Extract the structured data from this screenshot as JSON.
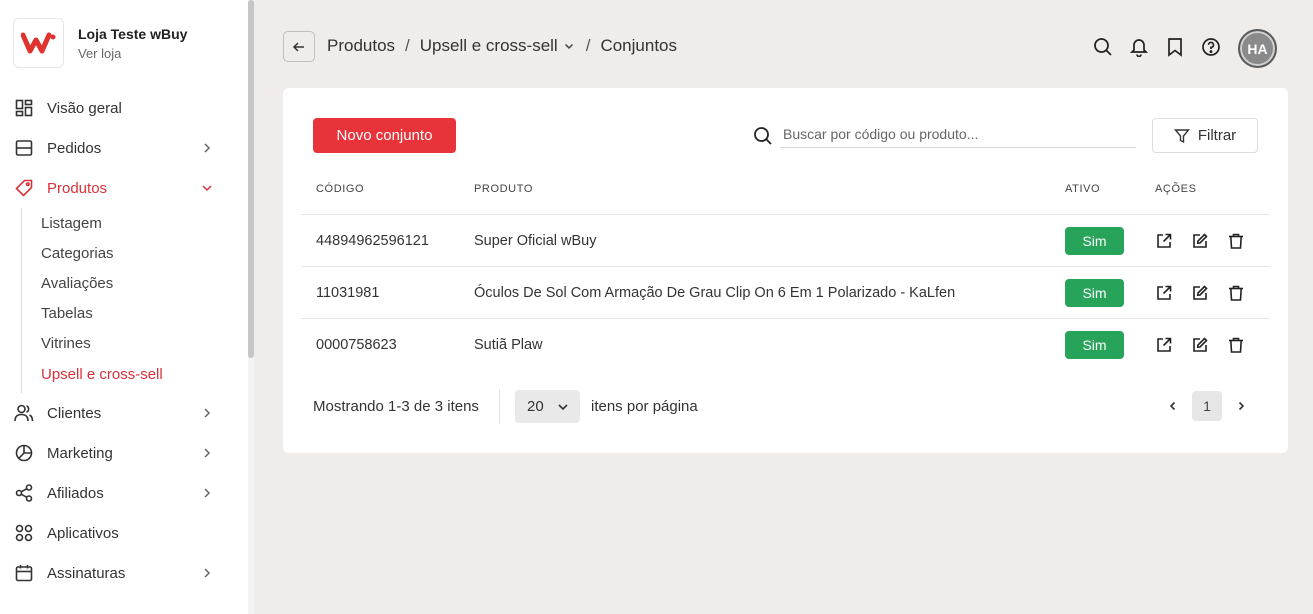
{
  "store": {
    "name": "Loja Teste wBuy",
    "link": "Ver loja"
  },
  "colors": {
    "accent": "#e8333a",
    "active_nav": "#d9323a",
    "badge_green": "#27a35a"
  },
  "sidebar": {
    "items": [
      {
        "label": "Visão geral",
        "icon": "dashboard-icon"
      },
      {
        "label": "Pedidos",
        "icon": "orders-icon"
      },
      {
        "label": "Produtos",
        "icon": "tag-icon"
      },
      {
        "label": "Clientes",
        "icon": "users-icon"
      },
      {
        "label": "Marketing",
        "icon": "pie-chart-icon"
      },
      {
        "label": "Afiliados",
        "icon": "share-icon"
      },
      {
        "label": "Aplicativos",
        "icon": "apps-icon"
      },
      {
        "label": "Assinaturas",
        "icon": "calendar-icon"
      }
    ],
    "produtos_sub": [
      "Listagem",
      "Categorias",
      "Avaliações",
      "Tabelas",
      "Vitrines",
      "Upsell e cross-sell"
    ]
  },
  "breadcrumb": {
    "items": [
      "Produtos",
      "Upsell e cross-sell",
      "Conjuntos"
    ]
  },
  "header": {
    "avatar": "HA"
  },
  "toolbar": {
    "new_label": "Novo conjunto",
    "search_placeholder": "Buscar por código ou produto...",
    "filter_label": "Filtrar"
  },
  "table": {
    "headers": [
      "CÓDIGO",
      "PRODUTO",
      "ATIVO",
      "AÇÕES"
    ],
    "rows": [
      {
        "code": "44894962596121",
        "product": "Super Oficial wBuy",
        "active": "Sim"
      },
      {
        "code": "11031981",
        "product": "Óculos De Sol Com Armação De Grau Clip On 6 Em 1 Polarizado - KaLfen",
        "active": "Sim"
      },
      {
        "code": "0000758623",
        "product": "Sutiã Plaw",
        "active": "Sim"
      }
    ]
  },
  "pagination": {
    "showing": "Mostrando 1-3 de 3 itens",
    "per_page": "20",
    "per_page_label": "itens por página",
    "current_page": "1"
  }
}
